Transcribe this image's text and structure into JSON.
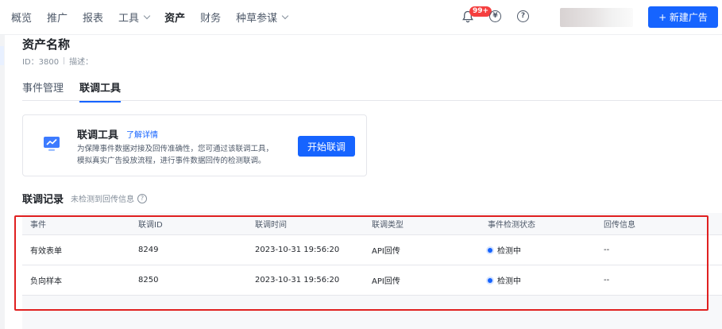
{
  "topnav": {
    "items": [
      {
        "label": "概览",
        "dropdown": false,
        "active": false
      },
      {
        "label": "推广",
        "dropdown": false,
        "active": false
      },
      {
        "label": "报表",
        "dropdown": false,
        "active": false
      },
      {
        "label": "工具",
        "dropdown": true,
        "active": false
      },
      {
        "label": "资产",
        "dropdown": false,
        "active": true
      },
      {
        "label": "财务",
        "dropdown": false,
        "active": false
      },
      {
        "label": "种草参谋",
        "dropdown": true,
        "active": false
      }
    ],
    "notification_badge": "99+",
    "currency_icon_glyph": "¥",
    "help_icon_glyph": "?",
    "new_ad_button": "+ 新建广告"
  },
  "header": {
    "title": "资产名称",
    "id_text": "ID：3800",
    "desc_text": "描述："
  },
  "tabs": [
    {
      "label": "事件管理",
      "active": false
    },
    {
      "label": "联调工具",
      "active": true
    }
  ],
  "tool_card": {
    "title": "联调工具",
    "link": "了解详情",
    "description": "为保障事件数据对接及回传准确性，您可通过该联调工具，模拟真实广告投放流程，进行事件数据回传的检测联调。",
    "start_button": "开始联调"
  },
  "records": {
    "title": "联调记录",
    "note": "未检测到回传信息",
    "columns": [
      "事件",
      "联调ID",
      "联调时间",
      "联调类型",
      "事件检测状态",
      "回传信息"
    ],
    "rows": [
      {
        "event": "有效表单",
        "id": "8249",
        "time": "2023-10-31 19:56:20",
        "type": "API回传",
        "status": "检测中",
        "info": "--"
      },
      {
        "event": "负向样本",
        "id": "8250",
        "time": "2023-10-31 19:56:20",
        "type": "API回传",
        "status": "检测中",
        "info": "--"
      }
    ]
  },
  "colors": {
    "primary": "#1664ff",
    "badge": "#f53f3f",
    "highlight_box": "#e02020"
  }
}
